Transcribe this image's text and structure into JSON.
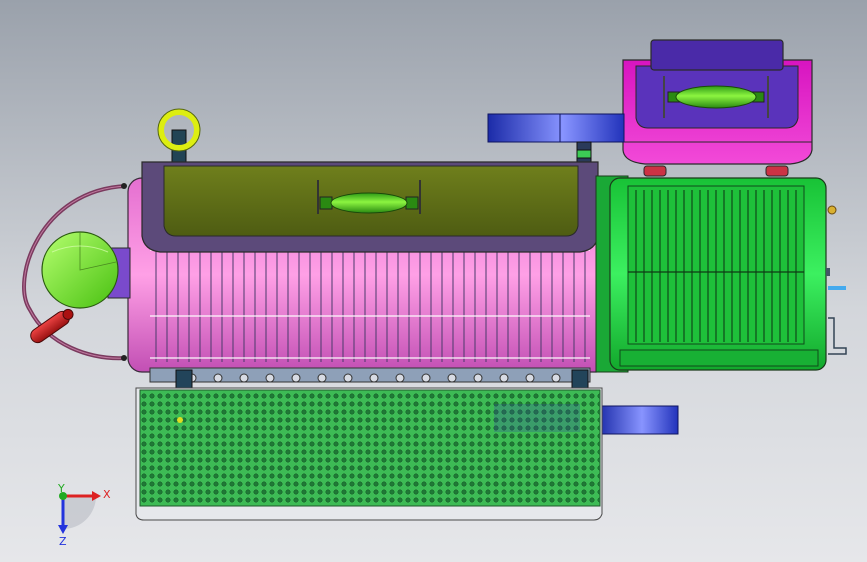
{
  "viewport": {
    "background_top": "#9aa1ab",
    "background_bottom": "#e6e7ea"
  },
  "parts": {
    "drum_shell": {
      "color": "#ff8ad8"
    },
    "drum_cover": {
      "color": "#5a6a1a"
    },
    "motor_housing": {
      "color": "#22dd44"
    },
    "top_box": {
      "color": "#e020c8"
    },
    "top_box_lid": {
      "color": "#5a33bb"
    },
    "perforated_tray": {
      "color": "#3dbb55"
    },
    "blue_bracket": {
      "color": "#3344cc"
    },
    "handle": {
      "color": "#55dd22"
    },
    "end_disc": {
      "color": "#7de81e"
    },
    "red_knob": {
      "color": "#cc2222"
    },
    "hoop": {
      "color": "#ddee11"
    }
  },
  "triad": {
    "x_label": "X",
    "y_label": "Y",
    "z_label": "Z",
    "x_color": "#dd2222",
    "y_color": "#22aa22",
    "z_color": "#2233dd"
  }
}
